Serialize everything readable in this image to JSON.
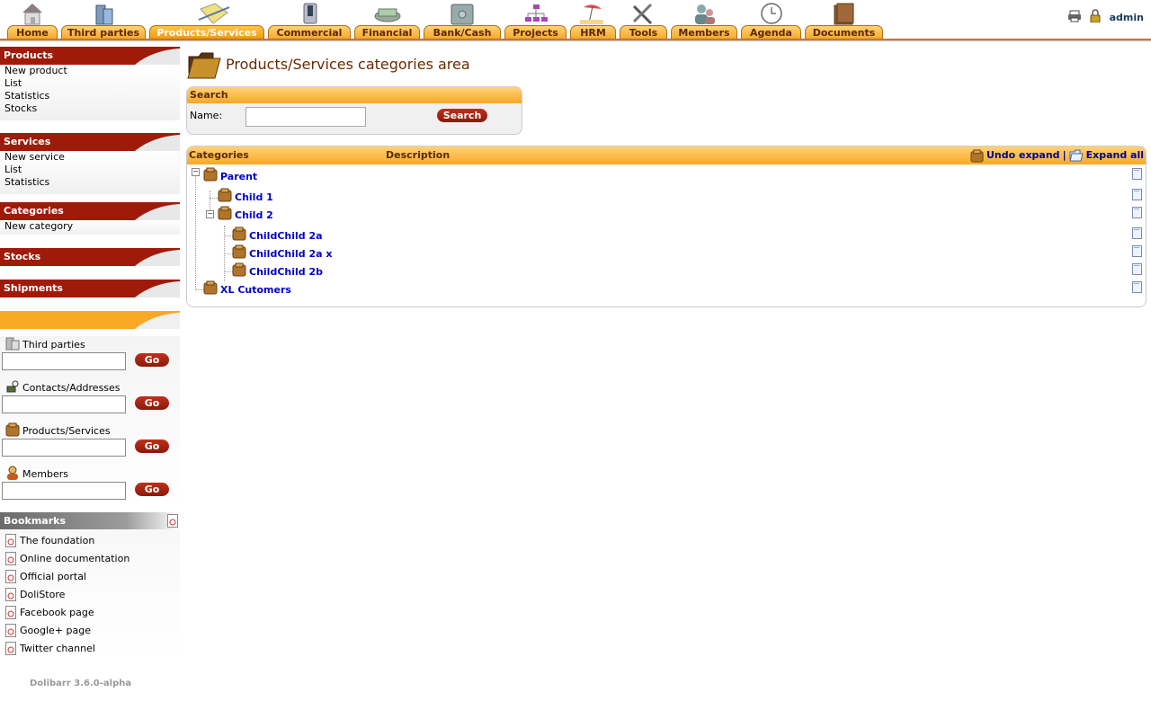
{
  "topmenu": {
    "tabs": [
      {
        "label": "Home",
        "icon": "home-icon"
      },
      {
        "label": "Third parties",
        "icon": "building-icon"
      },
      {
        "label": "Products/Services",
        "icon": "product-icon",
        "active": true
      },
      {
        "label": "Commercial",
        "icon": "commercial-icon"
      },
      {
        "label": "Financial",
        "icon": "money-icon"
      },
      {
        "label": "Bank/Cash",
        "icon": "safe-icon"
      },
      {
        "label": "Projects",
        "icon": "projects-icon"
      },
      {
        "label": "HRM",
        "icon": "beach-icon"
      },
      {
        "label": "Tools",
        "icon": "tools-icon"
      },
      {
        "label": "Members",
        "icon": "members-icon"
      },
      {
        "label": "Agenda",
        "icon": "clock-icon"
      },
      {
        "label": "Documents",
        "icon": "documents-icon"
      }
    ],
    "login": "admin"
  },
  "leftmenu": {
    "products": {
      "title": "Products",
      "items": [
        "New product",
        "List",
        "Statistics",
        "Stocks"
      ]
    },
    "services": {
      "title": "Services",
      "items": [
        "New service",
        "List",
        "Statistics"
      ]
    },
    "categories": {
      "title": "Categories",
      "items": [
        "New category"
      ]
    },
    "stocks": {
      "title": "Stocks"
    },
    "shipments": {
      "title": "Shipments"
    },
    "quicksearch": [
      {
        "label": "Third parties",
        "button": "Go"
      },
      {
        "label": "Contacts/Addresses",
        "button": "Go"
      },
      {
        "label": "Products/Services",
        "button": "Go"
      },
      {
        "label": "Members",
        "button": "Go"
      }
    ],
    "bookmarks": {
      "title": "Bookmarks",
      "items": [
        "The foundation",
        "Online documentation",
        "Official portal",
        "DoliStore",
        "Facebook page",
        "Google+ page",
        "Twitter channel"
      ]
    },
    "version": "Dolibarr 3.6.0-alpha"
  },
  "main": {
    "title": "Products/Services categories area",
    "search": {
      "header": "Search",
      "name_label": "Name:",
      "name_value": "",
      "button": "Search"
    },
    "categories": {
      "col_categories": "Categories",
      "col_description": "Description",
      "undo_expand": "Undo expand",
      "separator": "|",
      "expand_all": "Expand all",
      "tree": [
        {
          "name": "Parent",
          "level": 0
        },
        {
          "name": "Child 1",
          "level": 1
        },
        {
          "name": "Child 2",
          "level": 1
        },
        {
          "name": "ChildChild 2a",
          "level": 2
        },
        {
          "name": "ChildChild 2a x",
          "level": 2
        },
        {
          "name": "ChildChild 2b",
          "level": 2
        },
        {
          "name": "XL Cutomers",
          "level": 0
        }
      ]
    }
  },
  "colors": {
    "accent": "#f9a825",
    "menu_header": "#a01a0a",
    "link": "#0000cc",
    "title": "#6b2a00"
  }
}
